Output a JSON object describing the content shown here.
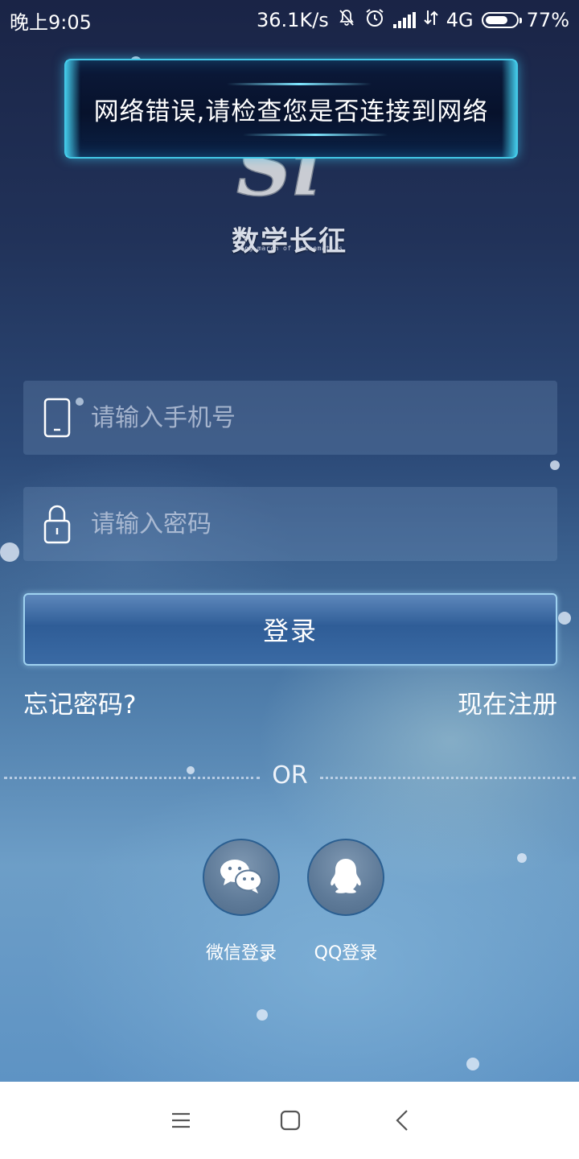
{
  "status_bar": {
    "time": "晚上9:05",
    "net_speed": "36.1K/s",
    "network_type": "4G",
    "battery_percent": "77%",
    "battery_level": 0.77
  },
  "toast": {
    "message": "网络错误,请检查您是否连接到网络"
  },
  "logo": {
    "mark_text": "Si",
    "title": "数学长征",
    "subtitle": "Long march of mathematics"
  },
  "form": {
    "phone_placeholder": "请输入手机号",
    "password_placeholder": "请输入密码",
    "login_label": "登录",
    "forgot_label": "忘记密码?",
    "register_label": "现在注册"
  },
  "divider": {
    "text": "OR"
  },
  "social": {
    "wechat_label": "微信登录",
    "qq_label": "QQ登录"
  },
  "nav_bar": {
    "icons": [
      "menu-icon",
      "home-icon",
      "back-icon"
    ]
  }
}
